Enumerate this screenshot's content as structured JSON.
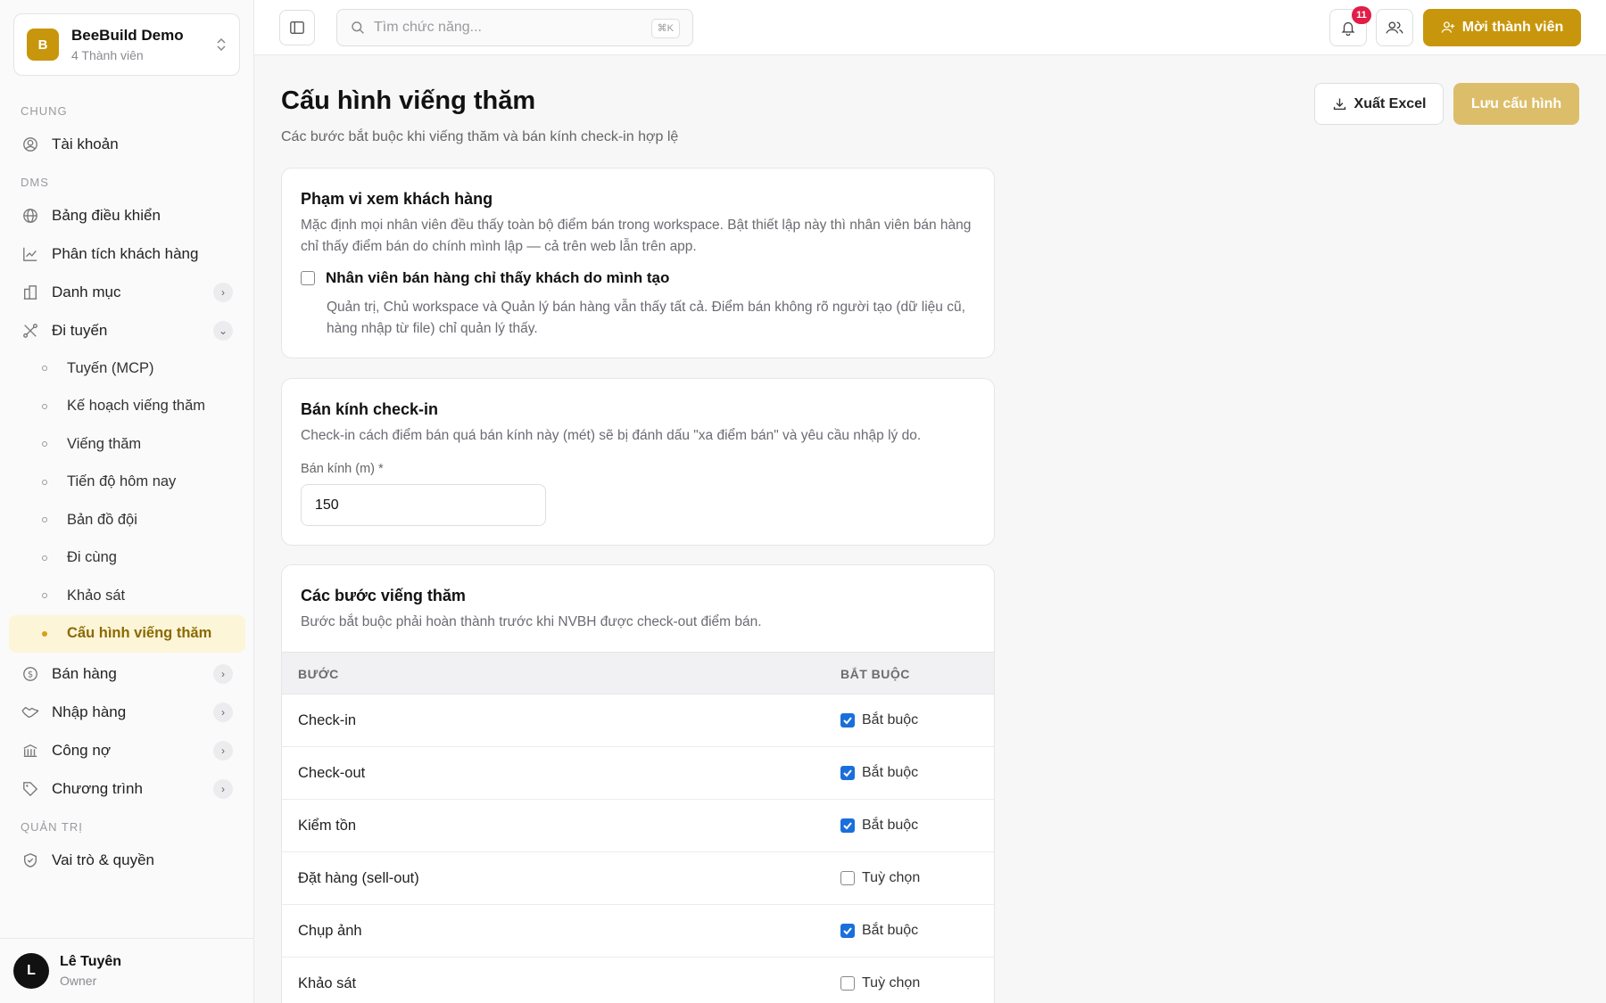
{
  "workspace": {
    "initial": "B",
    "name": "BeeBuild Demo",
    "members": "4 Thành viên"
  },
  "sidebar": {
    "sec_chung": "CHUNG",
    "account": "Tài khoản",
    "sec_dms": "DMS",
    "dashboard": "Bảng điều khiển",
    "analytics": "Phân tích khách hàng",
    "catalog": "Danh mục",
    "routes": "Đi tuyến",
    "sub": [
      "Tuyến (MCP)",
      "Kế hoạch viếng thăm",
      "Viếng thăm",
      "Tiến độ hôm nay",
      "Bản đồ đội",
      "Đi cùng",
      "Khảo sát",
      "Cấu hình viếng thăm"
    ],
    "sales": "Bán hàng",
    "import": "Nhập hàng",
    "debt": "Công nợ",
    "programs": "Chương trình",
    "sec_admin": "QUẢN TRỊ",
    "roles": "Vai trò & quyền"
  },
  "user": {
    "initial": "L",
    "name": "Lê Tuyên",
    "role": "Owner"
  },
  "topbar": {
    "search_placeholder": "Tìm chức năng...",
    "shortcut": "⌘K",
    "notif_count": "11",
    "invite_label": "Mời thành viên"
  },
  "page": {
    "title": "Cấu hình viếng thăm",
    "subtitle": "Các bước bắt buộc khi viếng thăm và bán kính check-in hợp lệ",
    "export_label": "Xuất Excel",
    "save_label": "Lưu cấu hình"
  },
  "scope": {
    "title": "Phạm vi xem khách hàng",
    "desc": "Mặc định mọi nhân viên đều thấy toàn bộ điểm bán trong workspace. Bật thiết lập này thì nhân viên bán hàng chỉ thấy điểm bán do chính mình lập — cả trên web lẫn trên app.",
    "option_label": "Nhân viên bán hàng chỉ thấy khách do mình tạo",
    "option_checked": false,
    "option_note": "Quản trị, Chủ workspace và Quản lý bán hàng vẫn thấy tất cả. Điểm bán không rõ người tạo (dữ liệu cũ, hàng nhập từ file) chỉ quản lý thấy."
  },
  "radius": {
    "title": "Bán kính check-in",
    "desc": "Check-in cách điểm bán quá bán kính này (mét) sẽ bị đánh dấu \"xa điểm bán\" và yêu cầu nhập lý do.",
    "field_label": "Bán kính (m) *",
    "value": "150"
  },
  "steps": {
    "title": "Các bước viếng thăm",
    "desc": "Bước bắt buộc phải hoàn thành trước khi NVBH được check-out điểm bán.",
    "col_step": "BƯỚC",
    "col_required": "BẮT BUỘC",
    "rows": [
      {
        "step": "Check-in",
        "required": true,
        "label": "Bắt buộc"
      },
      {
        "step": "Check-out",
        "required": true,
        "label": "Bắt buộc"
      },
      {
        "step": "Kiểm tồn",
        "required": true,
        "label": "Bắt buộc"
      },
      {
        "step": "Đặt hàng (sell-out)",
        "required": false,
        "label": "Tuỳ chọn"
      },
      {
        "step": "Chụp ảnh",
        "required": true,
        "label": "Bắt buộc"
      },
      {
        "step": "Khảo sát",
        "required": false,
        "label": "Tuỳ chọn"
      }
    ]
  },
  "colors": {
    "accent": "#c8960c",
    "accent_soft": "#dcbe6a",
    "active_bg": "#fdf5d8",
    "check_blue": "#1a6fdb",
    "badge_red": "#e11d48"
  }
}
